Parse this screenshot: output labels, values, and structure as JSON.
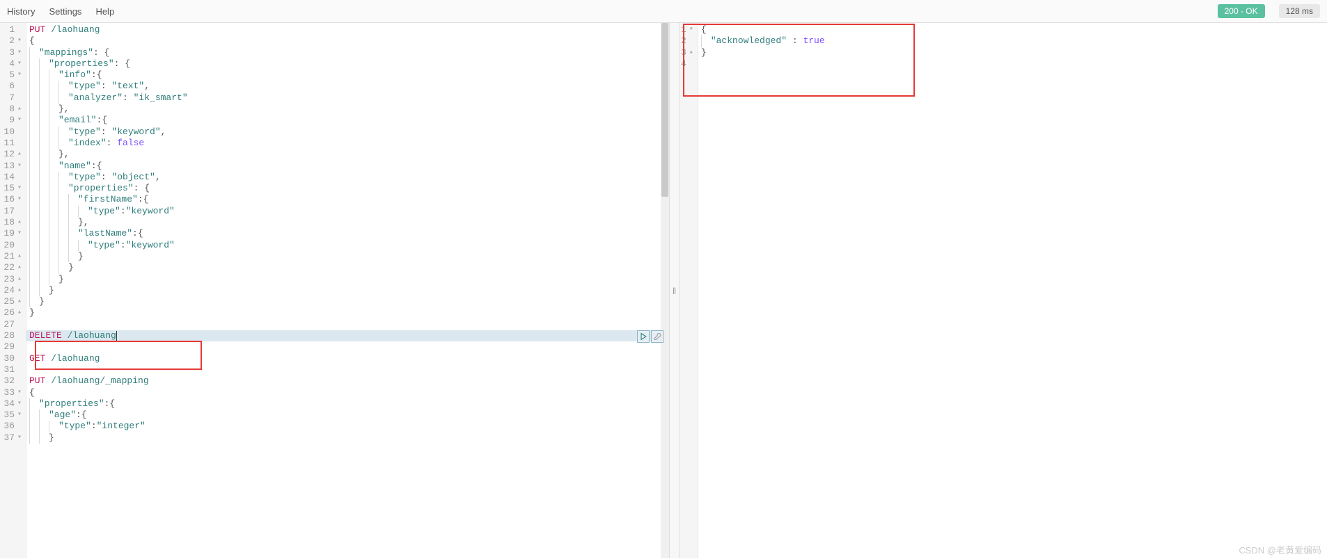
{
  "menu": {
    "history": "History",
    "settings": "Settings",
    "help": "Help"
  },
  "status": {
    "code": "200 - OK",
    "time": "128 ms"
  },
  "left_editor": {
    "lines": [
      {
        "n": 1,
        "fold": "",
        "tokens": [
          {
            "t": "PUT ",
            "c": "tok-method"
          },
          {
            "t": "/laohuang",
            "c": "tok-path"
          }
        ]
      },
      {
        "n": 2,
        "fold": "▾",
        "indent": 0,
        "tokens": [
          {
            "t": "{",
            "c": "tok-punct"
          }
        ]
      },
      {
        "n": 3,
        "fold": "▾",
        "indent": 1,
        "tokens": [
          {
            "t": "\"mappings\"",
            "c": "tok-key"
          },
          {
            "t": ": {",
            "c": "tok-punct"
          }
        ]
      },
      {
        "n": 4,
        "fold": "▾",
        "indent": 2,
        "tokens": [
          {
            "t": "\"properties\"",
            "c": "tok-key"
          },
          {
            "t": ": {",
            "c": "tok-punct"
          }
        ]
      },
      {
        "n": 5,
        "fold": "▾",
        "indent": 3,
        "tokens": [
          {
            "t": "\"info\"",
            "c": "tok-key"
          },
          {
            "t": ":{",
            "c": "tok-punct"
          }
        ]
      },
      {
        "n": 6,
        "fold": "",
        "indent": 4,
        "tokens": [
          {
            "t": "\"type\"",
            "c": "tok-key"
          },
          {
            "t": ": ",
            "c": "tok-punct"
          },
          {
            "t": "\"text\"",
            "c": "tok-string"
          },
          {
            "t": ",",
            "c": "tok-punct"
          }
        ]
      },
      {
        "n": 7,
        "fold": "",
        "indent": 4,
        "tokens": [
          {
            "t": "\"analyzer\"",
            "c": "tok-key"
          },
          {
            "t": ": ",
            "c": "tok-punct"
          },
          {
            "t": "\"ik_smart\"",
            "c": "tok-string"
          }
        ]
      },
      {
        "n": 8,
        "fold": "▴",
        "indent": 3,
        "tokens": [
          {
            "t": "},",
            "c": "tok-punct"
          }
        ]
      },
      {
        "n": 9,
        "fold": "▾",
        "indent": 3,
        "tokens": [
          {
            "t": "\"email\"",
            "c": "tok-key"
          },
          {
            "t": ":{",
            "c": "tok-punct"
          }
        ]
      },
      {
        "n": 10,
        "fold": "",
        "indent": 4,
        "tokens": [
          {
            "t": "\"type\"",
            "c": "tok-key"
          },
          {
            "t": ": ",
            "c": "tok-punct"
          },
          {
            "t": "\"keyword\"",
            "c": "tok-string"
          },
          {
            "t": ",",
            "c": "tok-punct"
          }
        ]
      },
      {
        "n": 11,
        "fold": "",
        "indent": 4,
        "tokens": [
          {
            "t": "\"index\"",
            "c": "tok-key"
          },
          {
            "t": ": ",
            "c": "tok-punct"
          },
          {
            "t": "false",
            "c": "tok-false"
          }
        ]
      },
      {
        "n": 12,
        "fold": "▴",
        "indent": 3,
        "tokens": [
          {
            "t": "},",
            "c": "tok-punct"
          }
        ]
      },
      {
        "n": 13,
        "fold": "▾",
        "indent": 3,
        "tokens": [
          {
            "t": "\"name\"",
            "c": "tok-key"
          },
          {
            "t": ":{",
            "c": "tok-punct"
          }
        ]
      },
      {
        "n": 14,
        "fold": "",
        "indent": 4,
        "tokens": [
          {
            "t": "\"type\"",
            "c": "tok-key"
          },
          {
            "t": ": ",
            "c": "tok-punct"
          },
          {
            "t": "\"object\"",
            "c": "tok-string"
          },
          {
            "t": ",",
            "c": "tok-punct"
          }
        ]
      },
      {
        "n": 15,
        "fold": "▾",
        "indent": 4,
        "tokens": [
          {
            "t": "\"properties\"",
            "c": "tok-key"
          },
          {
            "t": ": {",
            "c": "tok-punct"
          }
        ]
      },
      {
        "n": 16,
        "fold": "▾",
        "indent": 5,
        "tokens": [
          {
            "t": "\"firstName\"",
            "c": "tok-key"
          },
          {
            "t": ":{",
            "c": "tok-punct"
          }
        ]
      },
      {
        "n": 17,
        "fold": "",
        "indent": 6,
        "tokens": [
          {
            "t": "\"type\"",
            "c": "tok-key"
          },
          {
            "t": ":",
            "c": "tok-punct"
          },
          {
            "t": "\"keyword\"",
            "c": "tok-string"
          }
        ]
      },
      {
        "n": 18,
        "fold": "▴",
        "indent": 5,
        "tokens": [
          {
            "t": "},",
            "c": "tok-punct"
          }
        ]
      },
      {
        "n": 19,
        "fold": "▾",
        "indent": 5,
        "tokens": [
          {
            "t": "\"lastName\"",
            "c": "tok-key"
          },
          {
            "t": ":{",
            "c": "tok-punct"
          }
        ]
      },
      {
        "n": 20,
        "fold": "",
        "indent": 6,
        "tokens": [
          {
            "t": "\"type\"",
            "c": "tok-key"
          },
          {
            "t": ":",
            "c": "tok-punct"
          },
          {
            "t": "\"keyword\"",
            "c": "tok-string"
          }
        ]
      },
      {
        "n": 21,
        "fold": "▴",
        "indent": 5,
        "tokens": [
          {
            "t": "}",
            "c": "tok-punct"
          }
        ]
      },
      {
        "n": 22,
        "fold": "▴",
        "indent": 4,
        "tokens": [
          {
            "t": "}",
            "c": "tok-punct"
          }
        ]
      },
      {
        "n": 23,
        "fold": "▴",
        "indent": 3,
        "tokens": [
          {
            "t": "}",
            "c": "tok-punct"
          }
        ]
      },
      {
        "n": 24,
        "fold": "▴",
        "indent": 2,
        "tokens": [
          {
            "t": "}",
            "c": "tok-punct"
          }
        ]
      },
      {
        "n": 25,
        "fold": "▴",
        "indent": 1,
        "tokens": [
          {
            "t": "}",
            "c": "tok-punct"
          }
        ]
      },
      {
        "n": 26,
        "fold": "▴",
        "indent": 0,
        "tokens": [
          {
            "t": "}",
            "c": "tok-punct"
          }
        ]
      },
      {
        "n": 27,
        "fold": "",
        "tokens": []
      },
      {
        "n": 28,
        "fold": "",
        "active": true,
        "tokens": [
          {
            "t": "DELETE ",
            "c": "tok-method"
          },
          {
            "t": "/laohuang",
            "c": "tok-path"
          }
        ]
      },
      {
        "n": 29,
        "fold": "",
        "tokens": []
      },
      {
        "n": 30,
        "fold": "",
        "tokens": [
          {
            "t": "GET ",
            "c": "tok-method"
          },
          {
            "t": "/laohuang",
            "c": "tok-path"
          }
        ]
      },
      {
        "n": 31,
        "fold": "",
        "tokens": []
      },
      {
        "n": 32,
        "fold": "",
        "tokens": [
          {
            "t": "PUT ",
            "c": "tok-method"
          },
          {
            "t": "/laohuang/_mapping",
            "c": "tok-path"
          }
        ]
      },
      {
        "n": 33,
        "fold": "▾",
        "indent": 0,
        "tokens": [
          {
            "t": "{",
            "c": "tok-punct"
          }
        ]
      },
      {
        "n": 34,
        "fold": "▾",
        "indent": 1,
        "tokens": [
          {
            "t": "\"properties\"",
            "c": "tok-key"
          },
          {
            "t": ":{",
            "c": "tok-punct"
          }
        ]
      },
      {
        "n": 35,
        "fold": "▾",
        "indent": 2,
        "tokens": [
          {
            "t": "\"age\"",
            "c": "tok-key"
          },
          {
            "t": ":{",
            "c": "tok-punct"
          }
        ]
      },
      {
        "n": 36,
        "fold": "",
        "indent": 3,
        "tokens": [
          {
            "t": "\"type\"",
            "c": "tok-key"
          },
          {
            "t": ":",
            "c": "tok-punct"
          },
          {
            "t": "\"integer\"",
            "c": "tok-string"
          }
        ]
      },
      {
        "n": 37,
        "fold": "▾",
        "indent": 2,
        "tokens": [
          {
            "t": "}",
            "c": "tok-punct"
          }
        ]
      }
    ]
  },
  "right_editor": {
    "lines": [
      {
        "n": 1,
        "fold": "▾",
        "indent": 0,
        "tokens": [
          {
            "t": "{",
            "c": "tok-punct"
          }
        ]
      },
      {
        "n": 2,
        "fold": "",
        "indent": 1,
        "tokens": [
          {
            "t": "\"acknowledged\"",
            "c": "tok-key"
          },
          {
            "t": " : ",
            "c": "tok-punct"
          },
          {
            "t": "true",
            "c": "tok-true"
          }
        ]
      },
      {
        "n": 3,
        "fold": "▴",
        "indent": 0,
        "tokens": [
          {
            "t": "}",
            "c": "tok-punct"
          }
        ]
      },
      {
        "n": 4,
        "fold": "",
        "tokens": []
      }
    ]
  },
  "watermark": "CSDN @老黄爱编码"
}
